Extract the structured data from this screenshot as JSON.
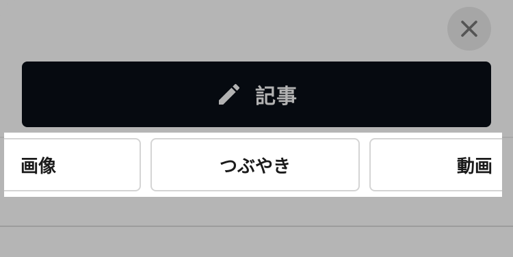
{
  "close": {
    "icon": "close-icon"
  },
  "article_button": {
    "label": "記事",
    "icon": "pencil-icon"
  },
  "post_types": [
    {
      "label": "画像"
    },
    {
      "label": "つぶやき"
    },
    {
      "label": "動画"
    }
  ],
  "colors": {
    "overlay_bg": "#b5b5b5",
    "primary_button_bg": "#060a10",
    "primary_button_text": "#b2b2b2",
    "chip_bg": "#ffffff",
    "chip_border": "#d4d4d4"
  }
}
